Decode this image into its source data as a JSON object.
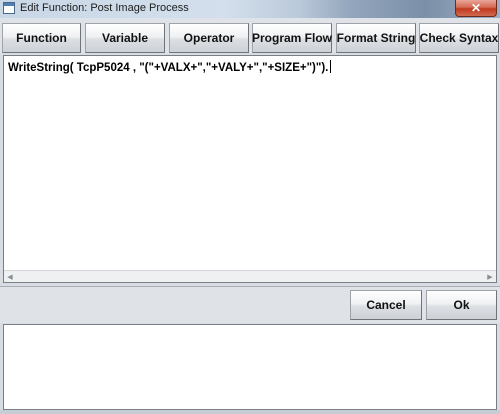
{
  "window": {
    "title": "Edit Function: Post Image Process",
    "close_symbol": "✕"
  },
  "toolbar": {
    "buttons": [
      {
        "label": "Function",
        "icon": null
      },
      {
        "label": "Variable",
        "icon": null
      },
      {
        "label": "Operator",
        "icon": null
      },
      {
        "label": "Program Flow",
        "icon": null
      },
      {
        "label": "Format String",
        "icon": null
      },
      {
        "label": "Check Syntax",
        "icon": null
      }
    ]
  },
  "editor": {
    "text": "WriteString( TcpP5024 , \"(\"+VALX+\",\"+VALY+\",\"+SIZE+\")\")."
  },
  "actions": {
    "cancel_label": "Cancel",
    "ok_label": "Ok"
  },
  "output": {
    "text": ""
  },
  "colors": {
    "close_button": "#c0391f",
    "background": "#d8dde4"
  },
  "icons": {
    "app": "window-app-icon",
    "close": "close-icon",
    "scroll_left": "arrow-left-icon",
    "scroll_right": "arrow-right-icon"
  }
}
